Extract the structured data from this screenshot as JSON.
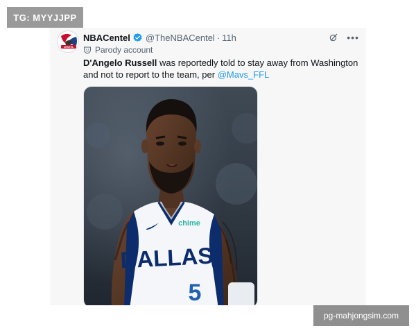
{
  "watermark_top": "TG: MYYJJPP",
  "watermark_bottom": "pg-mahjongsim.com",
  "tweet": {
    "display_name": "NBACentel",
    "handle": "@TheNBACentel",
    "separator": "·",
    "time": "11h",
    "label": "Parody account",
    "text_bold": "D'Angelo Russell",
    "text_rest": " was reportedly told to stay away from Washington and not to report to the team, per ",
    "mention": "@Mavs_FFL",
    "avatar_text": "CENTEL"
  },
  "photo": {
    "jersey_team": "DALLAS",
    "jersey_number": "5",
    "sponsor": "chime"
  },
  "icons": {
    "avatar": "nba-centel-logo-icon",
    "verified": "verified-badge-icon",
    "grok": "grok-icon",
    "more": "more-options-icon",
    "parody": "parody-account-icon"
  },
  "colors": {
    "link": "#1d9bf0",
    "verified": "#1d9bf0",
    "jersey_trim": "#0c2c6b",
    "jersey_number": "#1f5fb0",
    "sponsor": "#2bb3a3"
  }
}
